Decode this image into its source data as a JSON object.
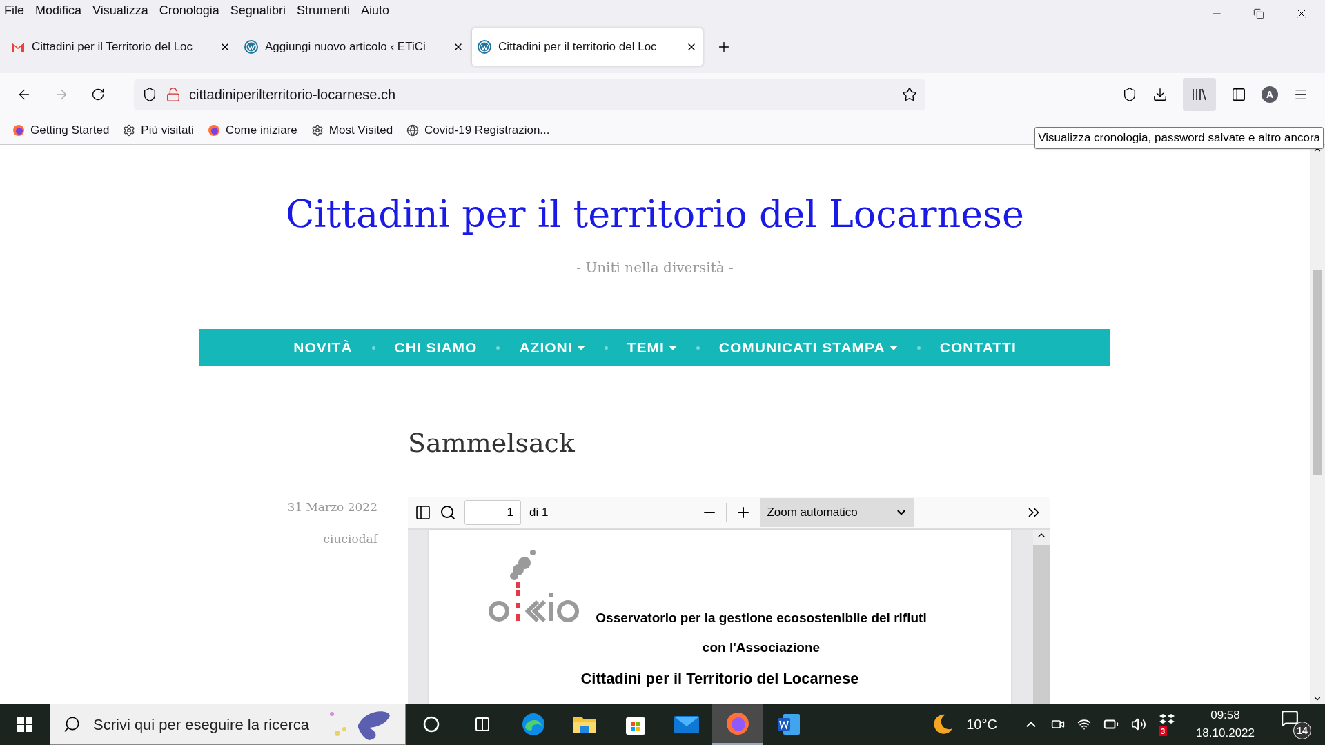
{
  "menu_bar": [
    "File",
    "Modifica",
    "Visualizza",
    "Cronologia",
    "Segnalibri",
    "Strumenti",
    "Aiuto"
  ],
  "tabs": [
    {
      "title": "Cittadini per il Territorio del Loc",
      "kind": "gmail",
      "selected": false
    },
    {
      "title": "Aggiungi nuovo articolo ‹ ETiCi",
      "kind": "wordpress",
      "selected": false
    },
    {
      "title": "Cittadini per il territorio del Loc",
      "kind": "wordpress",
      "selected": true
    }
  ],
  "address_bar": {
    "url": "cittadiniperilterritorio-locarnese.ch"
  },
  "toolbar": {
    "library_active": true,
    "account_initial": "A"
  },
  "bookmarks": [
    {
      "label": "Getting Started",
      "kind": "firefox"
    },
    {
      "label": "Più visitati",
      "kind": "gear"
    },
    {
      "label": "Come iniziare",
      "kind": "firefox"
    },
    {
      "label": "Most Visited",
      "kind": "gear"
    },
    {
      "label": "Covid-19 Registrazion...",
      "kind": "globe"
    }
  ],
  "tooltip": "Visualizza cronologia, password salvate e altro ancora",
  "site": {
    "title": "Cittadini per il territorio del Locarnese",
    "tagline": "- Uniti nella diversità -",
    "nav": [
      {
        "label": "NOVITÀ",
        "dropdown": false
      },
      {
        "label": "CHI SIAMO",
        "dropdown": false
      },
      {
        "label": "AZIONI",
        "dropdown": true
      },
      {
        "label": "TEMI",
        "dropdown": true
      },
      {
        "label": "COMUNICATI STAMPA",
        "dropdown": true
      },
      {
        "label": "CONTATTI",
        "dropdown": false
      }
    ]
  },
  "post": {
    "title": "Sammelsack",
    "date": "31 Marzo 2022",
    "author": "ciuciodaf"
  },
  "pdf_viewer": {
    "page": "1",
    "page_count": "di 1",
    "zoom": "Zoom automatico",
    "lines": [
      "Osservatorio per la gestione ecosostenibile dei rifiuti",
      "con l'Associazione",
      "Cittadini per il Territorio del Locarnese"
    ]
  },
  "taskbar": {
    "search_placeholder": "Scrivi qui per eseguire la ricerca",
    "apps": [
      {
        "kind": "cortana",
        "active": false
      },
      {
        "kind": "taskview",
        "active": false
      },
      {
        "kind": "edge",
        "active": false
      },
      {
        "kind": "explorer",
        "active": false
      },
      {
        "kind": "store",
        "active": false
      },
      {
        "kind": "mail",
        "active": false
      },
      {
        "kind": "firefox",
        "active": true
      },
      {
        "kind": "word",
        "active": false
      }
    ],
    "temperature": "10°C",
    "dropbox_badge": "3",
    "time": "09:58",
    "date": "18.10.2022",
    "notifications": "14"
  }
}
